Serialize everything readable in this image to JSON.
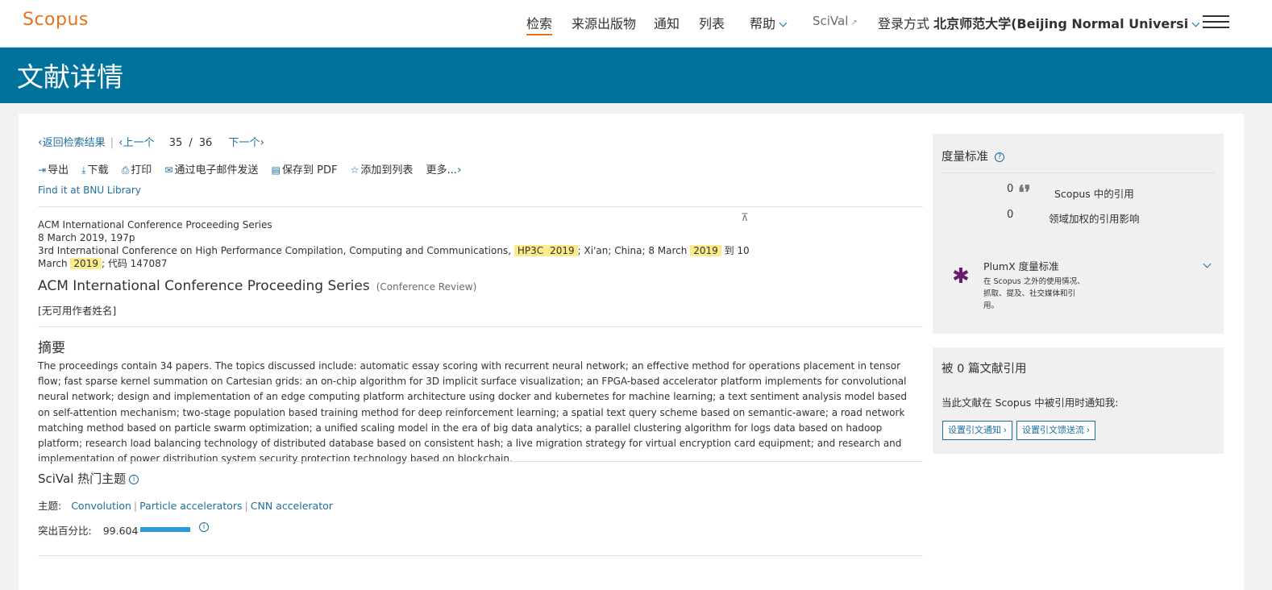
{
  "topnav": {
    "logo": "Scopus",
    "items": [
      "检索",
      "来源出版物",
      "通知",
      "列表",
      "帮助"
    ],
    "scival": "SciVal",
    "login_label": "登录方式",
    "institution": "北京师范大学(Beijing Normal Universi"
  },
  "banner": {
    "title": "文献详情"
  },
  "pager": {
    "back": "返回检索结果",
    "prev": "上一个",
    "current": "35",
    "slash": "/",
    "total": "36",
    "next": "下一个"
  },
  "toolbar": {
    "export": "导出",
    "download": "下载",
    "print": "打印",
    "email": "通过电子邮件发送",
    "save_pdf": "保存到 PDF",
    "add_list": "添加到列表",
    "more": "更多..."
  },
  "findit": "Find it at BNU Library",
  "source": {
    "series": "ACM International Conference Proceeding Series",
    "date_pages": "8 March 2019, 197p",
    "conf_prefix": "3rd International Conference on High Performance Compilation, Computing and Communications,",
    "hl1": "HP3C",
    "hl2": "2019",
    "mid1": "; Xi'an; China; 8 March",
    "hl3": "2019",
    "mid2": "到 10 March",
    "hl4": "2019",
    "suffix": "; 代码 147087"
  },
  "doc": {
    "title": "ACM International Conference Proceeding Series",
    "type": "(Conference Review)",
    "authors": "[无可用作者姓名]"
  },
  "abstract": {
    "heading": "摘要",
    "body": "The proceedings contain 34 papers. The topics discussed include: automatic essay scoring with recurrent neural network; an effective method for operations placement in tensor flow; fast sparse kernel summation on Cartesian grids: an on-chip algorithm for 3D implicit surface visualization; an FPGA-based accelerator platform implements for convolutional neural network; design and implementation of an edge computing platform architecture using docker and kubernetes for machine learning; a text sentiment analysis model based on self-attention mechanism; two-stage population based training method for deep reinforcement learning; a spatial text query scheme based on semantic-aware; a road network matching method based on particle swarm optimization; a unified scaling model in the era of big data analytics; a parallel clustering algorithm for logs data based on hadoop platform; research load balancing technology of distributed database based on consistent hash; a live migration strategy for virtual encryption card equipment; and research and implementation of power distribution system security protection technology based on blockchain."
  },
  "scival": {
    "heading": "SciVal 热门主题",
    "topic_label": "主题:",
    "topics": [
      "Convolution",
      "Particle accelerators",
      "CNN accelerator"
    ],
    "pct_label": "突出百分比:",
    "pct_value": "99.604",
    "pct_fraction": 0.996
  },
  "metrics": {
    "heading": "度量标准",
    "citations_count": "0",
    "citations_label": "Scopus 中的引用",
    "fwci_count": "0",
    "fwci_label": "领域加权的引用影响",
    "plumx_title": "PlumX 度量标准",
    "plumx_desc": "在 Scopus 之外的使用情况、抓取、提及、社交媒体和引用。"
  },
  "cited": {
    "heading": "被 0 篇文献引用",
    "note": "当此文献在 Scopus 中被引用时通知我:",
    "btn_alert": "设置引文通知",
    "btn_feed": "设置引文馈送流"
  }
}
